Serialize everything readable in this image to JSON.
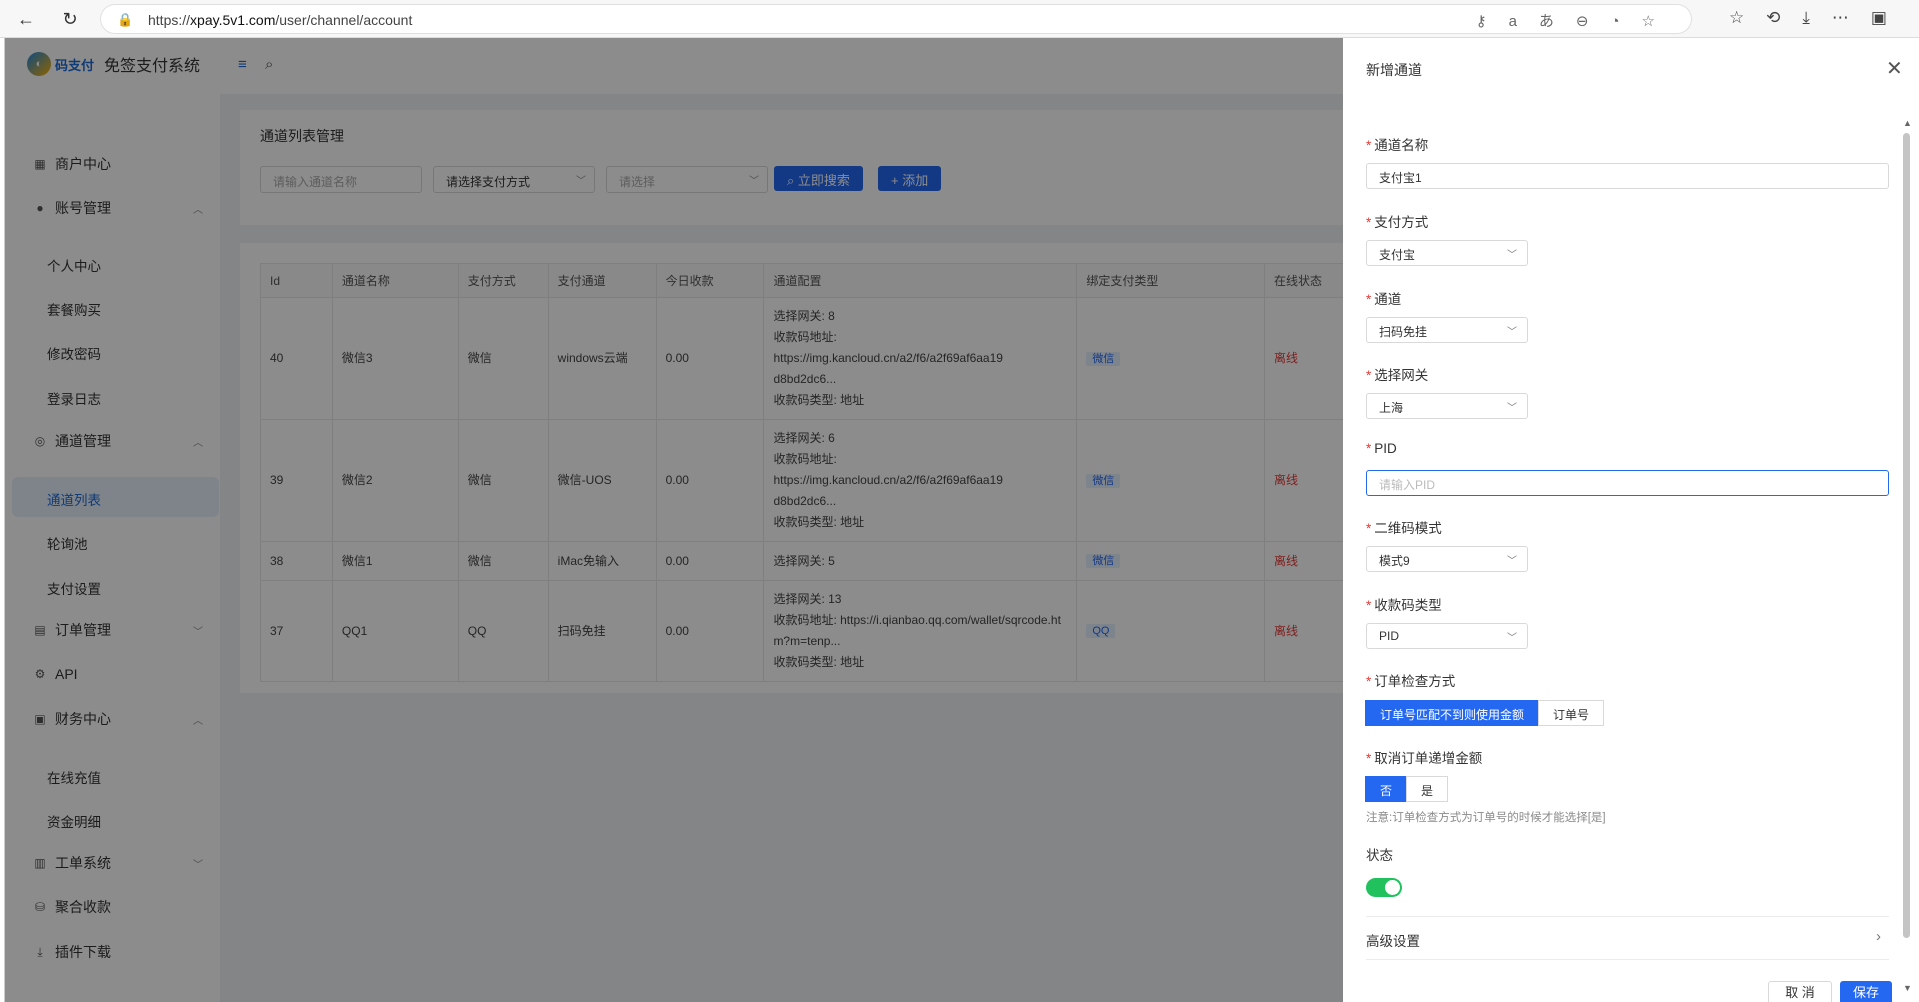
{
  "browser": {
    "url_prefix": "https://",
    "url_domain": "xpay.5v1.com",
    "url_path": "/user/channel/account"
  },
  "logo": {
    "brand": "码支付",
    "title": "免签支付系统"
  },
  "sidebar": {
    "merchant_center": "商户中心",
    "account_mgmt": "账号管理",
    "personal_center": "个人中心",
    "package_purchase": "套餐购买",
    "change_password": "修改密码",
    "login_log": "登录日志",
    "channel_mgmt": "通道管理",
    "channel_list": "通道列表",
    "polling_pool": "轮询池",
    "payment_settings": "支付设置",
    "order_mgmt": "订单管理",
    "api": "API",
    "finance_center": "财务中心",
    "online_recharge": "在线充值",
    "fund_details": "资金明细",
    "ticket_system": "工单系统",
    "aggregated_collection": "聚合收款",
    "plugin_download": "插件下载"
  },
  "filter_card": {
    "title": "通道列表管理",
    "name_placeholder": "请输入通道名称",
    "payment_method_placeholder": "请选择支付方式",
    "select_placeholder": "请选择",
    "search_button": "立即搜索",
    "add_button": "添加"
  },
  "table": {
    "headers": [
      "Id",
      "通道名称",
      "支付方式",
      "支付通道",
      "今日收款",
      "通道配置",
      "绑定支付类型",
      "在线状态"
    ],
    "rows": [
      {
        "id": "40",
        "name": "微信3",
        "method": "微信",
        "channel": "windows云端",
        "today": "0.00",
        "config1": "选择网关: 8",
        "config2": "收款码地址: https://img.kancloud.cn/a2/f6/a2f69af6aa19",
        "config3": "d8bd2dc6...",
        "config4": "收款码类型: 地址",
        "bind": "微信",
        "status": "离线"
      },
      {
        "id": "39",
        "name": "微信2",
        "method": "微信",
        "channel": "微信-UOS",
        "today": "0.00",
        "config1": "选择网关: 6",
        "config2": "收款码地址: https://img.kancloud.cn/a2/f6/a2f69af6aa19",
        "config3": "d8bd2dc6...",
        "config4": "收款码类型: 地址",
        "bind": "微信",
        "status": "离线"
      },
      {
        "id": "38",
        "name": "微信1",
        "method": "微信",
        "channel": "iMac免输入",
        "today": "0.00",
        "config1": "选择网关: 5",
        "bind": "微信",
        "status": "离线"
      },
      {
        "id": "37",
        "name": "QQ1",
        "method": "QQ",
        "channel": "扫码免挂",
        "today": "0.00",
        "config1": "选择网关: 13",
        "config2": "收款码地址: https://i.qianbao.qq.com/wallet/sqrcode.ht",
        "config3": "m?m=tenp...",
        "config4": "收款码类型: 地址",
        "bind": "QQ",
        "status": "离线"
      }
    ]
  },
  "drawer": {
    "title": "新增通道",
    "fields": {
      "channel_name_label": "通道名称",
      "channel_name_value": "支付宝1",
      "payment_method_label": "支付方式",
      "payment_method_value": "支付宝",
      "channel_label": "通道",
      "channel_value": "扫码免挂",
      "gateway_label": "选择网关",
      "gateway_value": "上海",
      "pid_label": "PID",
      "pid_placeholder": "请输入PID",
      "qr_mode_label": "二维码模式",
      "qr_mode_value": "模式9",
      "qr_type_label": "收款码类型",
      "qr_type_value": "PID",
      "order_check_label": "订单检查方式",
      "order_check_opt1": "订单号匹配不到则使用金额",
      "order_check_opt2": "订单号",
      "cancel_increment_label": "取消订单递增金额",
      "cancel_increment_no": "否",
      "cancel_increment_yes": "是",
      "note": "注意:订单检查方式为订单号的时候才能选择[是]",
      "status_label": "状态",
      "advanced_label": "高级设置"
    },
    "cancel_button": "取 消",
    "save_button": "保存"
  }
}
